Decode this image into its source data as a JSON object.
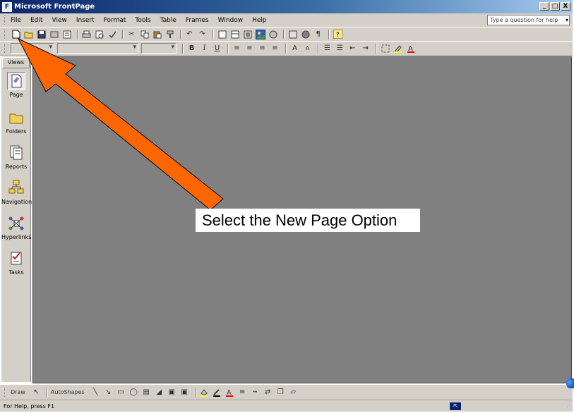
{
  "window": {
    "title": "Microsoft FrontPage",
    "app_icon_letter": "F"
  },
  "window_buttons": [
    "_",
    "□",
    "X"
  ],
  "menu": {
    "items": [
      "File",
      "Edit",
      "View",
      "Insert",
      "Format",
      "Tools",
      "Table",
      "Frames",
      "Window",
      "Help"
    ]
  },
  "ask": {
    "placeholder": "Type a question for help"
  },
  "views": {
    "header": "Views",
    "items": [
      {
        "label": "Page",
        "icon": "page-view-icon",
        "selected": true
      },
      {
        "label": "Folders",
        "icon": "folders-view-icon",
        "selected": false
      },
      {
        "label": "Reports",
        "icon": "reports-view-icon",
        "selected": false
      },
      {
        "label": "Navigation",
        "icon": "navigation-view-icon",
        "selected": false
      },
      {
        "label": "Hyperlinks",
        "icon": "hyperlinks-view-icon",
        "selected": false
      },
      {
        "label": "Tasks",
        "icon": "tasks-view-icon",
        "selected": false
      }
    ]
  },
  "callout": {
    "text": "Select the New Page Option"
  },
  "formatting": {
    "bold": "B",
    "italic": "I",
    "underline": "U"
  },
  "drawing": {
    "draw_label": "Draw",
    "autoshapes_label": "AutoShapes"
  },
  "status": {
    "text": "For Help, press F1"
  },
  "colors": {
    "workspace": "#808080",
    "chrome": "#d4d0c8",
    "arrow": "#ff6600",
    "title_start": "#0a246a"
  }
}
